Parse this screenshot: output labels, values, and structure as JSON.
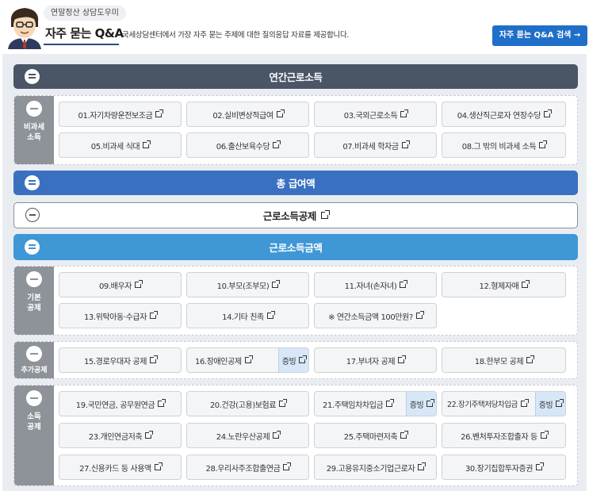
{
  "header": {
    "badge": "연말정산 상담도우미",
    "title": "자주 묻는 Q&A",
    "desc": "국세상담센터에서 가장 자주 묻는 주제에 대한 질의응답 자료를 제공합니다.",
    "search_btn": "자주 묻는 Q&A 검색 →"
  },
  "bars": {
    "annual": "연간근로소득",
    "total": "총 급여액",
    "deduction": "근로소득공제",
    "income": "근로소득금액"
  },
  "sections": {
    "nontax": {
      "label1": "비과세",
      "label2": "소득",
      "items": [
        "01.자기차량운전보조금",
        "02.실비변상적급여",
        "03.국외근로소득",
        "04.생산직근로자 연장수당",
        "05.비과세 식대",
        "06.출산보육수당",
        "07.비과세 학자금",
        "08.그 밖의 비과세 소득"
      ]
    },
    "basic": {
      "label1": "기본",
      "label2": "공제",
      "items": [
        "09.배우자",
        "10.부모(조부모)",
        "11.자녀(손자녀)",
        "12.형제자매",
        "13.위탁아동·수급자",
        "14.기타 친족",
        "※ 연간소득금액 100만원?"
      ]
    },
    "additional": {
      "label1": "추가공제",
      "items": [
        "15.경로우대자 공제",
        "16.장애인공제",
        "17.부녀자 공제",
        "18.한부모 공제"
      ],
      "tag": "증빙"
    },
    "income_ded": {
      "label1": "소득",
      "label2": "공제",
      "items": [
        "19.국민연금, 공무원연금",
        "20.건강(고용)보험료",
        "21.주택임차차입금",
        "22.장기주택저당차입금",
        "23.개인연금저축",
        "24.노란우산공제",
        "25.주택마련저축",
        "26.벤처투자조합출자 등",
        "27.신용카드 등 사용액",
        "28.우리사주조합출연금",
        "29.고용유지중소기업근로자",
        "30.장기집합투자증권"
      ],
      "tag": "증빙"
    }
  }
}
